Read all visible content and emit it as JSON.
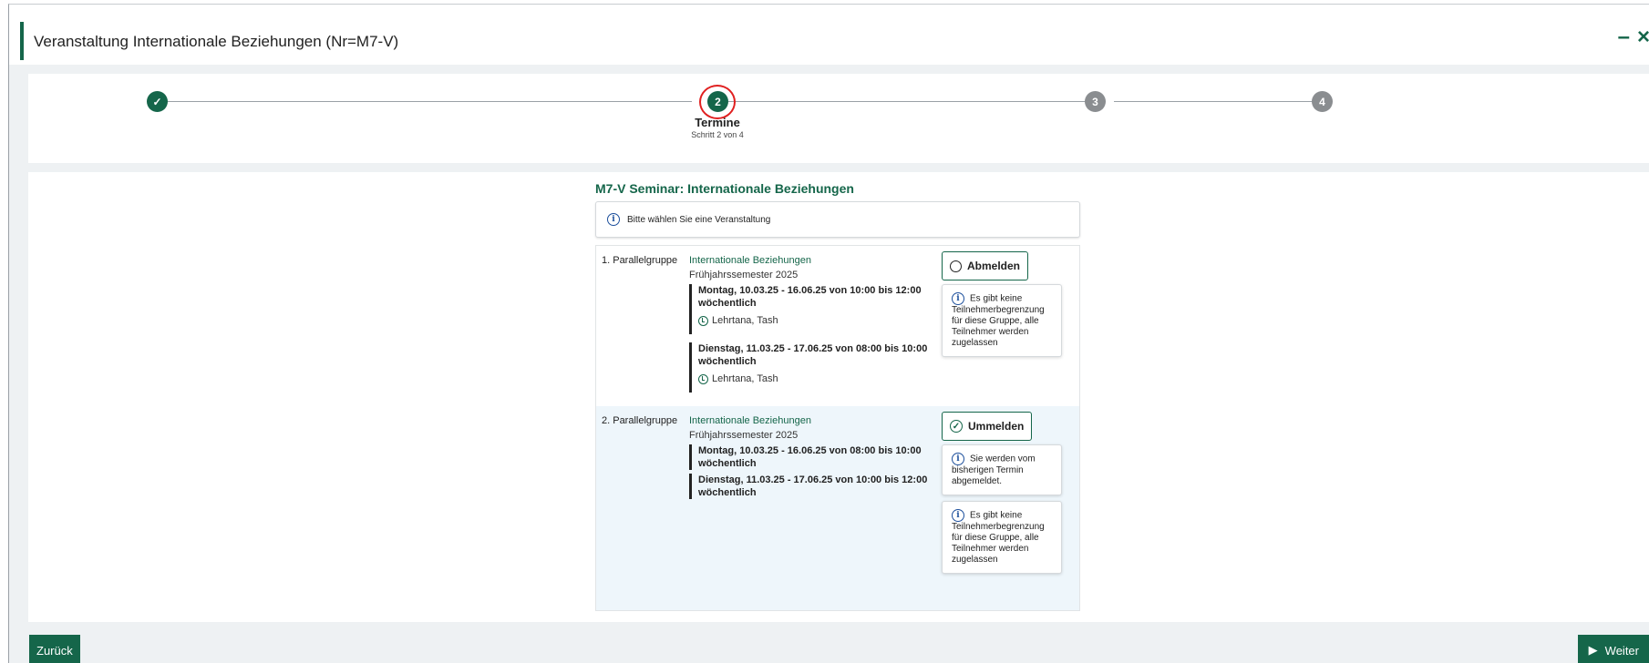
{
  "dialog": {
    "title": "Veranstaltung Internationale Beziehungen (Nr=M7-V)",
    "minimize_glyph": "–",
    "close_glyph": "×"
  },
  "stepper": {
    "steps": [
      {
        "number": "✓",
        "state": "done"
      },
      {
        "number": "2",
        "state": "active",
        "label": "Termine",
        "sub": "Schritt 2 von 4"
      },
      {
        "number": "3",
        "state": "todo"
      },
      {
        "number": "4",
        "state": "todo"
      }
    ]
  },
  "main": {
    "section_title": "M7-V Seminar: Internationale Beziehungen",
    "info_text": "Bitte wählen Sie eine Veranstaltung",
    "groups": [
      {
        "label": "1. Parallelgruppe",
        "name": "Internationale Beziehungen",
        "semester": "Frühjahrssemester 2025",
        "terms": [
          {
            "line1": "Montag, 10.03.25 - 16.06.25 von 10:00 bis 12:00",
            "line2": "wöchentlich",
            "room": "Lehrtana, Tash"
          },
          {
            "line1": "Dienstag, 11.03.25 - 17.06.25 von 08:00 bis 10:00",
            "line2": "wöchentlich",
            "room": "Lehrtana, Tash"
          }
        ],
        "button_label": "Abmelden",
        "notes": [
          "Es gibt keine Teilnehmerbegrenzung für diese Gruppe, alle Teilnehmer werden zugelassen"
        ]
      },
      {
        "label": "2. Parallelgruppe",
        "name": "Internationale Beziehungen",
        "semester": "Frühjahrssemester 2025",
        "terms": [
          {
            "line1": "Montag, 10.03.25 - 16.06.25 von 08:00 bis 10:00",
            "line2": "wöchentlich"
          },
          {
            "line1": "Dienstag, 11.03.25 - 17.06.25 von 10:00 bis 12:00",
            "line2": "wöchentlich"
          }
        ],
        "button_label": "Ummelden",
        "notes": [
          "Sie werden vom bisherigen Termin abgemeldet.",
          "Es gibt keine Teilnehmerbegrenzung für diese Gruppe, alle Teilnehmer werden zugelassen"
        ]
      }
    ]
  },
  "footer": {
    "back_label": "Zurück",
    "next_label": "Weiter"
  },
  "colors": {
    "accent": "#15664a",
    "step_todo": "#8a8d90",
    "highlight_ring": "#e02020",
    "group2_bg": "#eef6fb"
  }
}
